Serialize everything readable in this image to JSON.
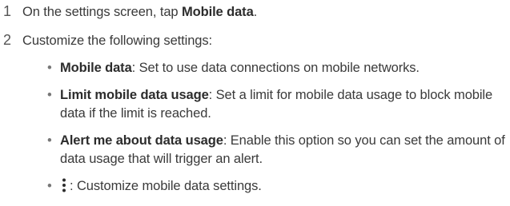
{
  "steps": [
    {
      "number": "1",
      "prefix": "On the settings screen, tap ",
      "bold": "Mobile data",
      "suffix": "."
    },
    {
      "number": "2",
      "text": "Customize the following settings:"
    }
  ],
  "bullets": [
    {
      "term": "Mobile data",
      "text": ": Set to use data connections on mobile networks."
    },
    {
      "term": "Limit mobile data usage",
      "text": ": Set a limit for mobile data usage to block mobile data if the limit is reached."
    },
    {
      "term": "Alert me about data usage",
      "text": ": Enable this option so you can set the amount of data usage that will trigger an alert."
    },
    {
      "icon": "more-vertical-icon",
      "text": ": Customize mobile data settings."
    }
  ],
  "bullet_symbol": "•"
}
